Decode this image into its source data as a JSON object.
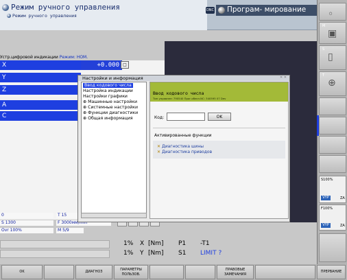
{
  "header": {
    "title": "Режим ручного управления",
    "subtitle": "Режим ручного управления",
    "dnc": "DNC",
    "program_mode": "Програм- мирование"
  },
  "position": {
    "status_prefix": "Устр.цифровой индикации",
    "mode_label": "Режим: НОМ.",
    "axes": [
      {
        "label": "X",
        "value": "+0.000"
      },
      {
        "label": "Y",
        "value": ""
      },
      {
        "label": "Z",
        "value": ""
      },
      {
        "label": "",
        "value": ""
      },
      {
        "label": "A",
        "value": ""
      },
      {
        "label": "C",
        "value": ""
      }
    ],
    "bottom": {
      "row1_left": "0",
      "row1_right": "T 15",
      "row2_left": "S 1300",
      "row2_right": "F 3000мм/min",
      "row3_left": "Ovr 100%",
      "row3_right": "M 5/9"
    }
  },
  "dialog": {
    "title": "Настройки и информация",
    "tree": [
      {
        "label": "Ввод кодового числа",
        "selected": true
      },
      {
        "label": "Настройка индикации",
        "selected": false
      },
      {
        "label": "Настройки графики",
        "selected": false
      },
      {
        "label": "⊕ Машинные настройки",
        "selected": false
      },
      {
        "label": "⊕ Системные настройки",
        "selected": false
      },
      {
        "label": "⊕ Функции диагностики",
        "selected": false
      },
      {
        "label": "⊕ Общая информация",
        "selected": false
      }
    ],
    "panel_title": "Ввод кодового числа",
    "panel_info": "Тип управлен: 790540   Прог.обесп.NC: 340595 07 Dev",
    "code_label": "Код:",
    "ok": "OK",
    "active_label": "Активированные функции",
    "functions": [
      "Диагностика шины",
      "Диагностика приводов"
    ]
  },
  "status": {
    "row1": {
      "pct": "1%",
      "axis": "X",
      "unit": "[Nm]",
      "p": "P1",
      "t": "-T1"
    },
    "row2": {
      "pct": "1%",
      "axis": "Y",
      "unit": "[Nm]",
      "s": "S1",
      "limit": "LIMIT ?"
    }
  },
  "right_column": {
    "m_label": "M",
    "s_label": "S",
    "t_label": "T",
    "s_override": "S100%",
    "f_override": "F100%",
    "vyp": "VYP",
    "za": "ZA"
  },
  "softkeys": [
    "OK",
    "",
    "ДИАГНОЗ",
    "ПАРАМЕТРЫ ПОЛЬЗОВ.",
    "",
    "",
    "ПРАВОВЫЕ ЗАМЕЧАНИЯ",
    "",
    "ПРЕРВАНИЕ"
  ]
}
